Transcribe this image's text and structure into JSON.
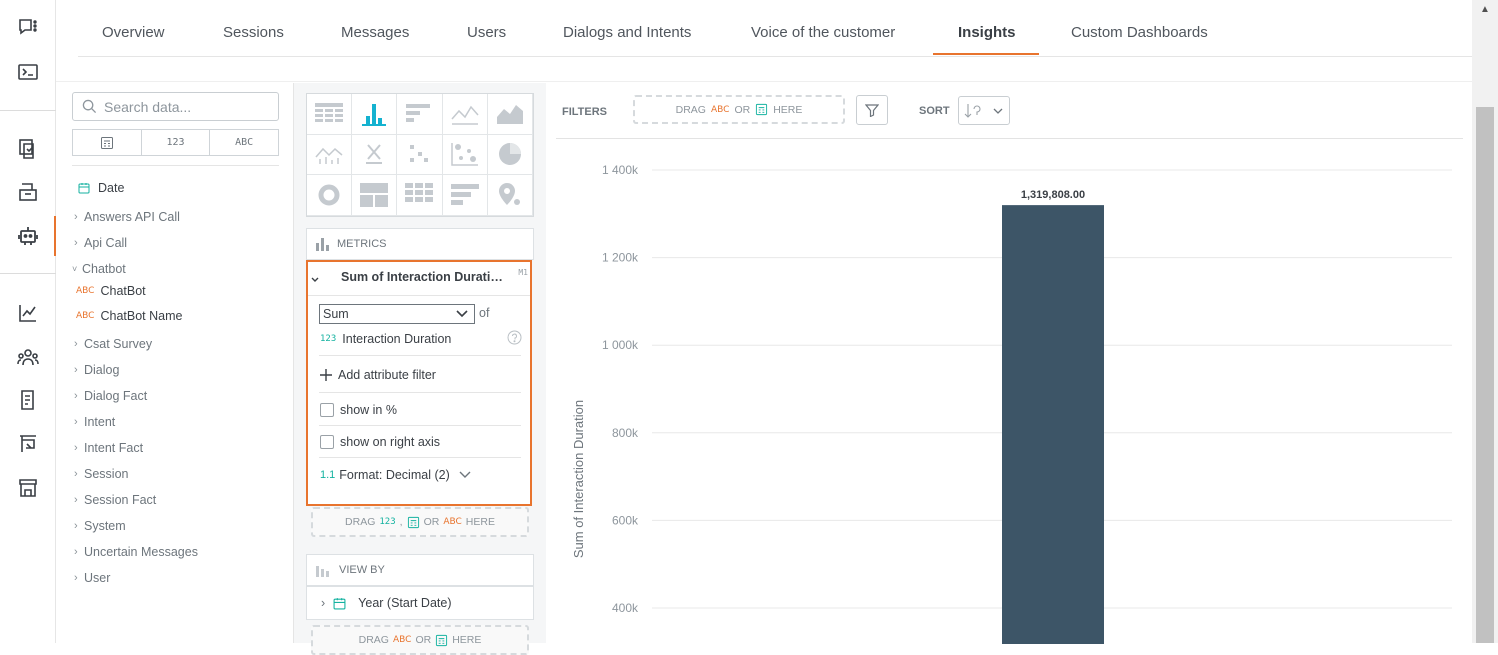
{
  "rail": {
    "icons": [
      "chat-icon",
      "terminal-icon",
      "documents-icon",
      "inbox-icon",
      "bot-icon",
      "chart-line-icon",
      "users-group-icon",
      "report-icon",
      "dashboard-icon",
      "store-icon"
    ]
  },
  "nav": {
    "tabs": [
      {
        "label": "Overview"
      },
      {
        "label": "Sessions"
      },
      {
        "label": "Messages"
      },
      {
        "label": "Users"
      },
      {
        "label": "Dialogs and Intents"
      },
      {
        "label": "Voice of the customer"
      },
      {
        "label": "Insights",
        "active": true
      },
      {
        "label": "Custom Dashboards"
      }
    ]
  },
  "catalog": {
    "search_placeholder": "Search data...",
    "type_filters": [
      "123",
      "ABC"
    ],
    "items": [
      {
        "label": "Date",
        "kind": "date"
      },
      {
        "label": "Answers API Call",
        "kind": "folder"
      },
      {
        "label": "Api Call",
        "kind": "folder"
      },
      {
        "label": "Chatbot",
        "kind": "folder-open"
      },
      {
        "label": "ChatBot",
        "kind": "attribute",
        "type_tag": "ABC"
      },
      {
        "label": "ChatBot Name",
        "kind": "attribute",
        "type_tag": "ABC"
      },
      {
        "label": "Csat Survey",
        "kind": "folder"
      },
      {
        "label": "Dialog",
        "kind": "folder"
      },
      {
        "label": "Dialog Fact",
        "kind": "folder"
      },
      {
        "label": "Intent",
        "kind": "folder"
      },
      {
        "label": "Intent Fact",
        "kind": "folder"
      },
      {
        "label": "Session",
        "kind": "folder"
      },
      {
        "label": "Session Fact",
        "kind": "folder"
      },
      {
        "label": "System",
        "kind": "folder"
      },
      {
        "label": "Uncertain Messages",
        "kind": "folder"
      },
      {
        "label": "User",
        "kind": "folder"
      }
    ]
  },
  "config": {
    "metrics_header": "METRICS",
    "metric": {
      "title": "Sum of Interaction Durati…",
      "id": "M1",
      "aggregation": "Sum",
      "of_label": "of",
      "measure_tag": "123",
      "measure": "Interaction Duration",
      "add_filter": "Add attribute filter",
      "show_percent": "show in %",
      "show_right_axis": "show on right axis",
      "format_tag": "1.1",
      "format": "Format: Decimal (2)"
    },
    "metric_drop": {
      "drag": "DRAG",
      "tag_num": "123",
      "comma": ",",
      "or": "OR",
      "tag_abc": "ABC",
      "here": "HERE"
    },
    "viewby_header": "VIEW BY",
    "viewby_item": "Year (Start Date)",
    "viewby_drop": {
      "drag": "DRAG",
      "tag_abc": "ABC",
      "or": "OR",
      "here": "HERE"
    }
  },
  "canvas": {
    "filters_label": "FILTERS",
    "filter_drop": {
      "drag": "DRAG",
      "tag_abc": "ABC",
      "or": "OR",
      "here": "HERE"
    },
    "sort_label": "SORT"
  },
  "chart_data": {
    "type": "bar",
    "categories": [
      ""
    ],
    "values": [
      1319808.0
    ],
    "data_labels": [
      "1,319,808.00"
    ],
    "ylabel": "Sum of Interaction Duration",
    "yticks": [
      "400k",
      "600k",
      "800k",
      "1 000k",
      "1 200k",
      "1 400k"
    ],
    "ylim": [
      0,
      1400000
    ],
    "bar_color": "#3d5567",
    "grid": true
  },
  "colors": {
    "accent": "#e8742e",
    "number_tag": "#14b2a0",
    "date_icon": "#14b2a0"
  }
}
